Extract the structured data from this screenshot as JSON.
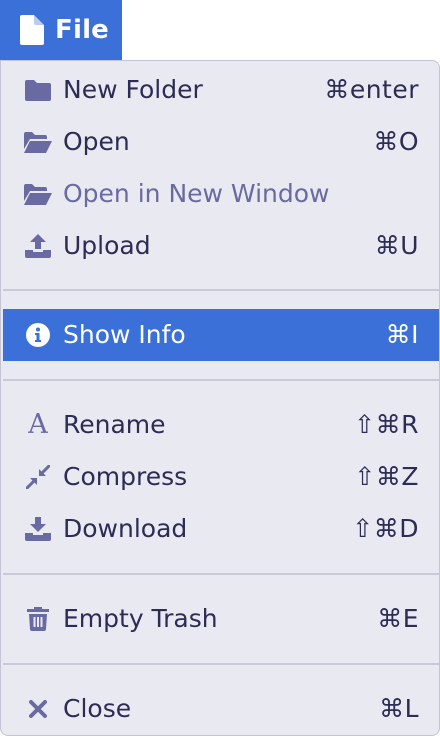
{
  "file_tab": {
    "label": "File"
  },
  "menu": {
    "items": [
      {
        "label": "New Folder",
        "shortcut": "⌘enter",
        "icon": "folder-icon"
      },
      {
        "label": "Open",
        "shortcut": "⌘O",
        "icon": "folder-open-icon"
      },
      {
        "label": "Open in New Window",
        "shortcut": "",
        "icon": "folder-open-icon",
        "disabled": true
      },
      {
        "label": "Upload",
        "shortcut": "⌘U",
        "icon": "upload-icon"
      },
      {
        "label": "Show Info",
        "shortcut": "⌘I",
        "icon": "info-icon",
        "active": true
      },
      {
        "label": "Rename",
        "shortcut": "⇧⌘R",
        "icon": "font-icon",
        "icon_glyph": "A"
      },
      {
        "label": "Compress",
        "shortcut": "⇧⌘Z",
        "icon": "compress-icon"
      },
      {
        "label": "Download",
        "shortcut": "⇧⌘D",
        "icon": "download-icon"
      },
      {
        "label": "Empty Trash",
        "shortcut": "⌘E",
        "icon": "trash-icon"
      },
      {
        "label": "Close",
        "shortcut": "⌘L",
        "icon": "close-icon"
      }
    ]
  },
  "colors": {
    "accent": "#3a70d8",
    "menu_bg": "#e9e9f1",
    "text": "#2c2c54",
    "icon": "#6a6aa2",
    "disabled_text": "#6a6aa2"
  }
}
